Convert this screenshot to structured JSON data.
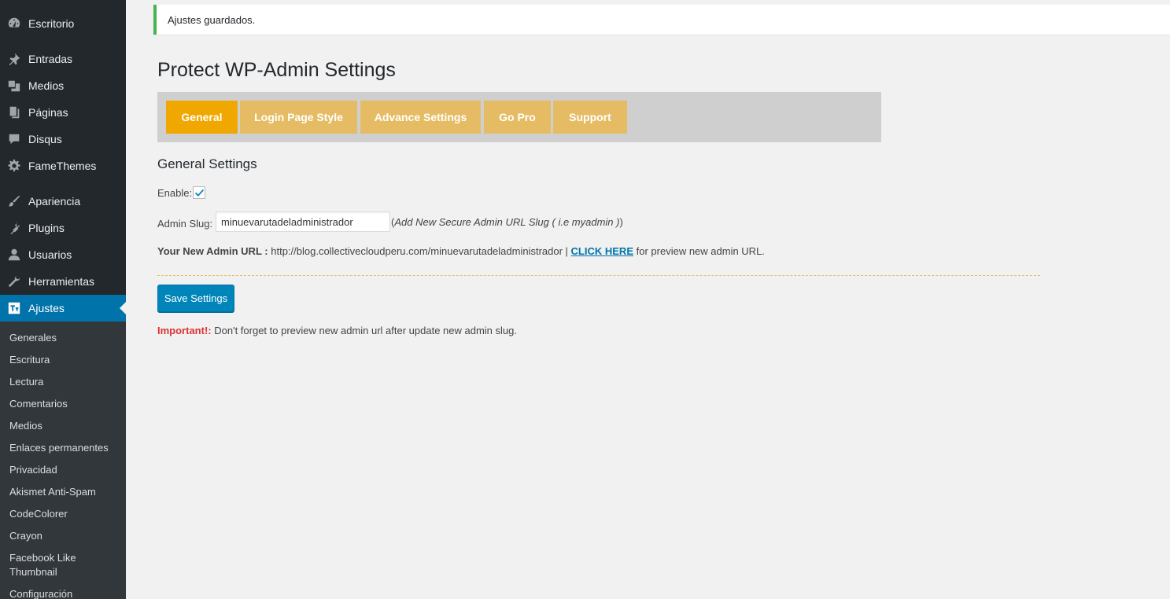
{
  "sidebar": {
    "menu": [
      {
        "label": "Escritorio",
        "icon": "dashboard-icon"
      },
      {
        "label": "Entradas",
        "icon": "pushpin-icon"
      },
      {
        "label": "Medios",
        "icon": "media-icon"
      },
      {
        "label": "Páginas",
        "icon": "pages-icon"
      },
      {
        "label": "Disqus",
        "icon": "comment-icon"
      },
      {
        "label": "FameThemes",
        "icon": "gear-icon"
      },
      {
        "label": "Apariencia",
        "icon": "brush-icon"
      },
      {
        "label": "Plugins",
        "icon": "plug-icon"
      },
      {
        "label": "Usuarios",
        "icon": "user-icon"
      },
      {
        "label": "Herramientas",
        "icon": "wrench-icon"
      },
      {
        "label": "Ajustes",
        "icon": "settings-icon"
      }
    ],
    "submenu": [
      "Generales",
      "Escritura",
      "Lectura",
      "Comentarios",
      "Medios",
      "Enlaces permanentes",
      "Privacidad",
      "Akismet Anti-Spam",
      "CodeColorer",
      "Crayon",
      "Facebook Like Thumbnail",
      "Configuración"
    ]
  },
  "notice": "Ajustes guardados.",
  "page_title": "Protect WP-Admin Settings",
  "tabs": [
    "General",
    "Login Page Style",
    "Advance Settings",
    "Go Pro",
    "Support"
  ],
  "section_title": "General Settings",
  "form": {
    "enable_label": "Enable:",
    "enable_checked": true,
    "slug_label": "Admin Slug:",
    "slug_value": "minuevarutadeladministrador",
    "slug_hint_open": "(",
    "slug_hint_text": "Add New Secure Admin URL Slug ( i.e myadmin )",
    "slug_hint_close": ")",
    "admin_url_label": "Your New Admin URL :",
    "admin_url": "http://blog.collectivecloudperu.com/minuevarutadeladministrador |",
    "click_here": "CLICK HERE",
    "preview_text": "for preview new admin URL.",
    "save_label": "Save Settings",
    "important_label": "Important!:",
    "important_text": "Don't forget to preview new admin url after update new admin slug."
  },
  "colors": {
    "sidebar_bg": "#23282d",
    "accent": "#0073aa",
    "tab_active": "#f0a800",
    "tab_inactive": "#e5bc64",
    "notice_border": "#46b450",
    "important": "#dc3232"
  }
}
